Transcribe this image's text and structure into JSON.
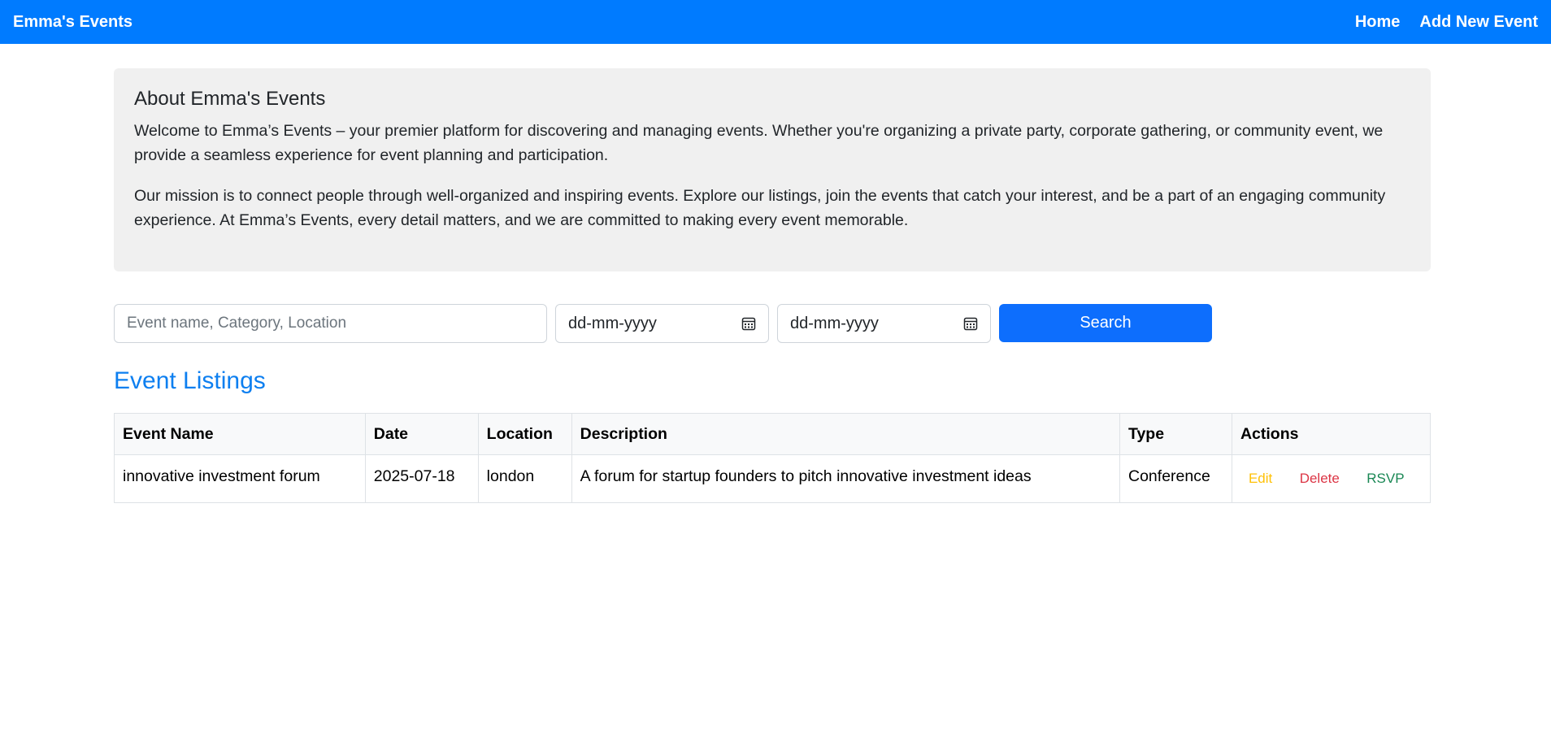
{
  "navbar": {
    "brand": "Emma's Events",
    "links": [
      "Home",
      "Add New Event"
    ]
  },
  "about": {
    "title": "About Emma's Events",
    "paragraphs": [
      "Welcome to Emma’s Events – your premier platform for discovering and managing events. Whether you're organizing a private party, corporate gathering, or community event, we provide a seamless experience for event planning and participation.",
      "Our mission is to connect people through well-organized and inspiring events. Explore our listings, join the events that catch your interest, and be a part of an engaging community experience. At Emma’s Events, every detail matters, and we are committed to making every event memorable."
    ]
  },
  "search": {
    "placeholder": "Event name, Category, Location",
    "value": "",
    "start_date": "dd-mm-yyyy",
    "end_date": "dd-mm-yyyy",
    "button_label": "Search",
    "calendar_icon": "calendar-icon"
  },
  "listings": {
    "title": "Event Listings",
    "columns": [
      "Event Name",
      "Date",
      "Location",
      "Description",
      "Type",
      "Actions"
    ],
    "rows": [
      {
        "name": "innovative investment forum",
        "date": "2025-07-18",
        "location": "london",
        "description": "A forum for startup founders to pitch innovative investment ideas",
        "type": "Conference",
        "actions": [
          "Edit",
          "Delete",
          "RSVP"
        ]
      }
    ]
  },
  "colors": {
    "navbar": "#007bff",
    "primary_button": "#0d6efd",
    "listings_title": "#0d7ff0",
    "edit": "#ffc107",
    "delete": "#dc3545",
    "rsvp": "#198754",
    "about_bg": "#f0f0f0"
  }
}
